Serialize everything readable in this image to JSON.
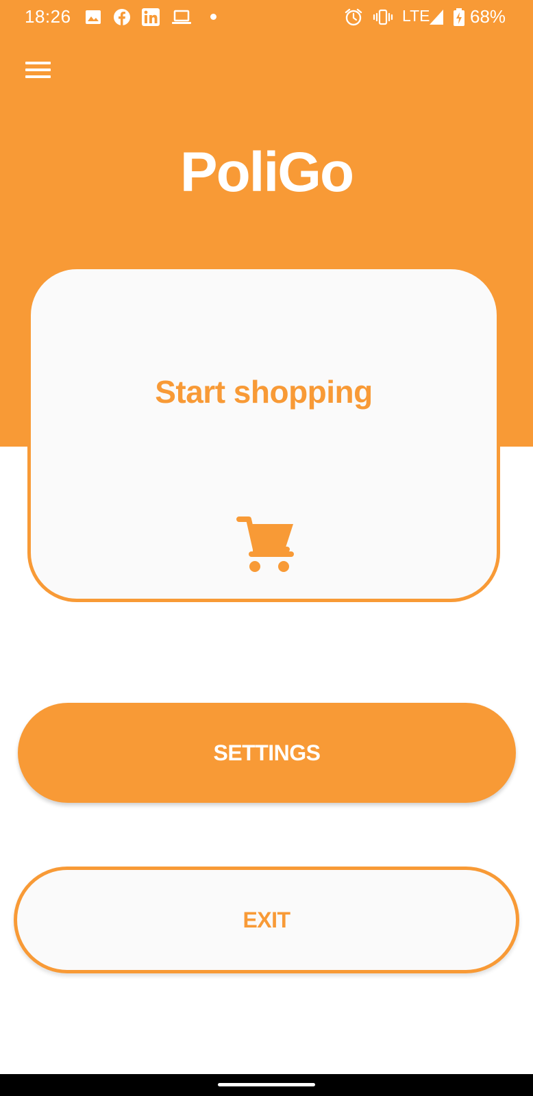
{
  "status_bar": {
    "time": "18:26",
    "notification_icons": [
      "image-icon",
      "facebook-icon",
      "linkedin-icon",
      "laptop-icon"
    ],
    "system_icons": [
      "alarm-icon",
      "vibrate-icon",
      "signal-icon",
      "battery-icon"
    ],
    "network": "LTE",
    "battery": "68%"
  },
  "header": {
    "menu_icon": "hamburger-menu-icon",
    "title": "PoliGo"
  },
  "shop_card": {
    "label": "Start shopping",
    "icon": "shopping-cart-icon"
  },
  "buttons": {
    "settings_label": "SETTINGS",
    "exit_label": "EXIT"
  },
  "colors": {
    "brand_orange": "#f89a36",
    "card_background": "#fafafa",
    "page_background": "#ffffff",
    "nav_bar": "#000000"
  }
}
